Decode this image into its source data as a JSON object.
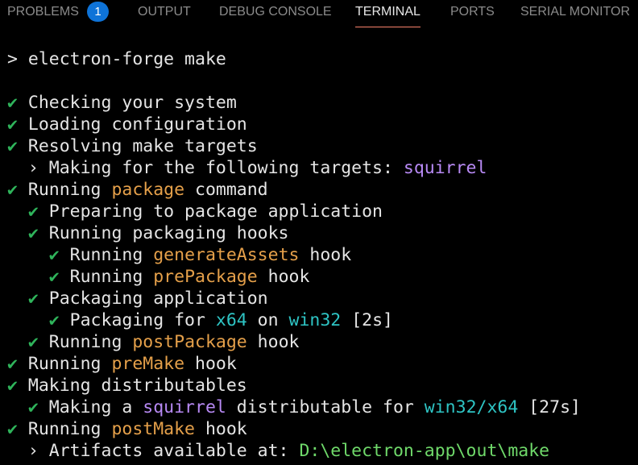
{
  "tabs": [
    {
      "label": "PROBLEMS",
      "badge": "1",
      "active": false
    },
    {
      "label": "OUTPUT",
      "active": false
    },
    {
      "label": "DEBUG CONSOLE",
      "active": false
    },
    {
      "label": "TERMINAL",
      "active": true
    },
    {
      "label": "PORTS",
      "active": false
    },
    {
      "label": "SERIAL MONITOR",
      "active": false
    }
  ],
  "colors": {
    "background": "#000000",
    "text": "#e5e5e5",
    "check": "#2fb45b",
    "highlight_orange": "#e5a04a",
    "highlight_cyan": "#2ec4c4",
    "highlight_purple": "#b88af5",
    "highlight_green": "#6fd96a",
    "active_tab_underline": "#f9826c",
    "badge": "#0e73d8"
  },
  "terminal": {
    "lines": [
      {
        "segments": [
          {
            "text": "> electron-forge make",
            "style": "prompt"
          }
        ]
      },
      {
        "segments": []
      },
      {
        "segments": [
          {
            "text": "✔ ",
            "style": "check"
          },
          {
            "text": "Checking your system"
          }
        ]
      },
      {
        "segments": [
          {
            "text": "✔ ",
            "style": "check"
          },
          {
            "text": "Loading configuration"
          }
        ]
      },
      {
        "segments": [
          {
            "text": "✔ ",
            "style": "check"
          },
          {
            "text": "Resolving make targets"
          }
        ]
      },
      {
        "segments": [
          {
            "text": "  › ",
            "style": "arrow"
          },
          {
            "text": "Making for the following targets: "
          },
          {
            "text": "squirrel",
            "style": "purple"
          }
        ]
      },
      {
        "segments": [
          {
            "text": "✔ ",
            "style": "check"
          },
          {
            "text": "Running "
          },
          {
            "text": "package",
            "style": "orange"
          },
          {
            "text": " command"
          }
        ]
      },
      {
        "segments": [
          {
            "text": "  ✔ ",
            "style": "check"
          },
          {
            "text": "Preparing to package application"
          }
        ]
      },
      {
        "segments": [
          {
            "text": "  ✔ ",
            "style": "check"
          },
          {
            "text": "Running packaging hooks"
          }
        ]
      },
      {
        "segments": [
          {
            "text": "    ✔ ",
            "style": "check"
          },
          {
            "text": "Running "
          },
          {
            "text": "generateAssets",
            "style": "orange"
          },
          {
            "text": " hook"
          }
        ]
      },
      {
        "segments": [
          {
            "text": "    ✔ ",
            "style": "check"
          },
          {
            "text": "Running "
          },
          {
            "text": "prePackage",
            "style": "orange"
          },
          {
            "text": " hook"
          }
        ]
      },
      {
        "segments": [
          {
            "text": "  ✔ ",
            "style": "check"
          },
          {
            "text": "Packaging application"
          }
        ]
      },
      {
        "segments": [
          {
            "text": "    ✔ ",
            "style": "check"
          },
          {
            "text": "Packaging for "
          },
          {
            "text": "x64",
            "style": "cyan"
          },
          {
            "text": " on "
          },
          {
            "text": "win32",
            "style": "cyan"
          },
          {
            "text": " [2s]"
          }
        ]
      },
      {
        "segments": [
          {
            "text": "  ✔ ",
            "style": "check"
          },
          {
            "text": "Running "
          },
          {
            "text": "postPackage",
            "style": "orange"
          },
          {
            "text": " hook"
          }
        ]
      },
      {
        "segments": [
          {
            "text": "✔ ",
            "style": "check"
          },
          {
            "text": "Running "
          },
          {
            "text": "preMake",
            "style": "orange"
          },
          {
            "text": " hook"
          }
        ]
      },
      {
        "segments": [
          {
            "text": "✔ ",
            "style": "check"
          },
          {
            "text": "Making distributables"
          }
        ]
      },
      {
        "segments": [
          {
            "text": "  ✔ ",
            "style": "check"
          },
          {
            "text": "Making a "
          },
          {
            "text": "squirrel",
            "style": "purple"
          },
          {
            "text": " distributable for "
          },
          {
            "text": "win32/x64",
            "style": "cyan"
          },
          {
            "text": " [27s]"
          }
        ]
      },
      {
        "segments": [
          {
            "text": "✔ ",
            "style": "check"
          },
          {
            "text": "Running "
          },
          {
            "text": "postMake",
            "style": "orange"
          },
          {
            "text": " hook"
          }
        ]
      },
      {
        "segments": [
          {
            "text": "  › ",
            "style": "arrow"
          },
          {
            "text": "Artifacts available at: "
          },
          {
            "text": "D:\\electron-app\\out\\make",
            "style": "green"
          }
        ]
      }
    ]
  }
}
